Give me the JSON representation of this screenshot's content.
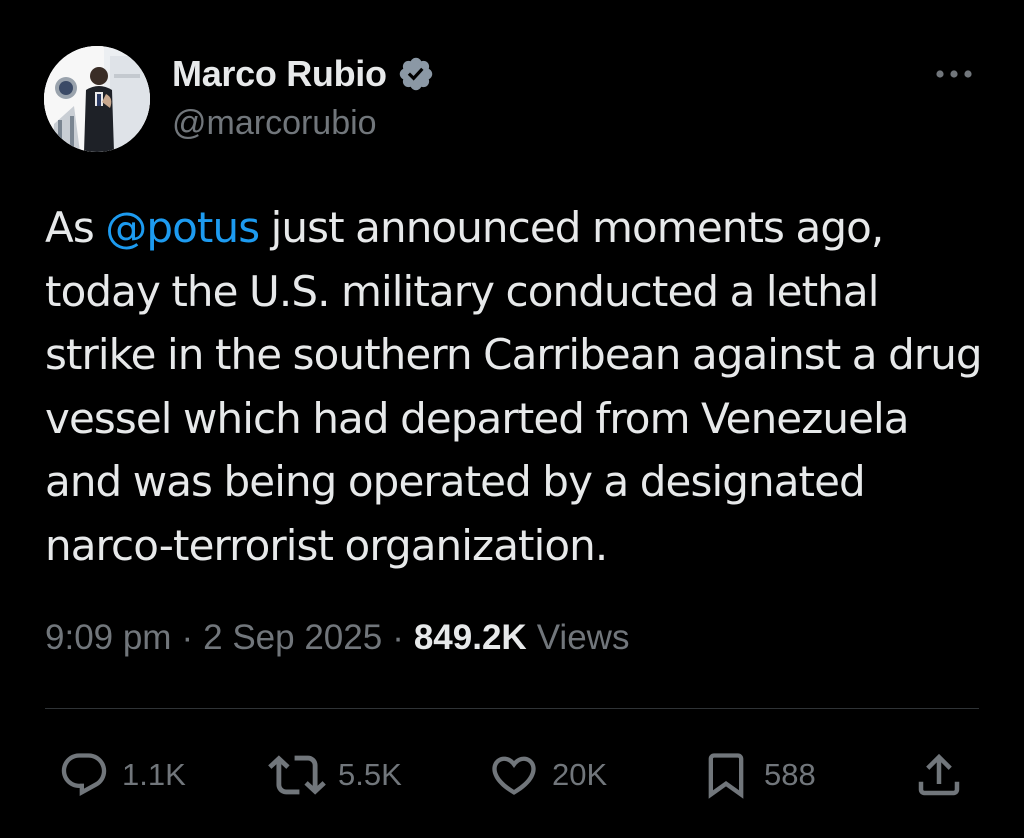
{
  "author": {
    "display_name": "Marco Rubio",
    "handle": "@marcorubio",
    "verified_icon": "verified-badge-icon",
    "verified_color": "#8b98a5"
  },
  "tweet": {
    "text_before": "As ",
    "mention": "@potus",
    "text_after": " just announced moments ago, today the U.S. military conducted a lethal strike in the southern Carribean against a drug vessel which had departed from Venezuela and was being operated by a designated narco-terrorist organization."
  },
  "meta": {
    "time": "9:09 pm",
    "separator": "·",
    "date": "2 Sep 2025",
    "views_count": "849.2K",
    "views_label": "Views"
  },
  "actions": {
    "replies": "1.1K",
    "reposts": "5.5K",
    "likes": "20K",
    "bookmarks": "588"
  },
  "colors": {
    "background": "#000000",
    "text": "#e7e9ea",
    "secondary": "#71767b",
    "accent": "#1d9bf0",
    "divider": "#2f3336"
  }
}
